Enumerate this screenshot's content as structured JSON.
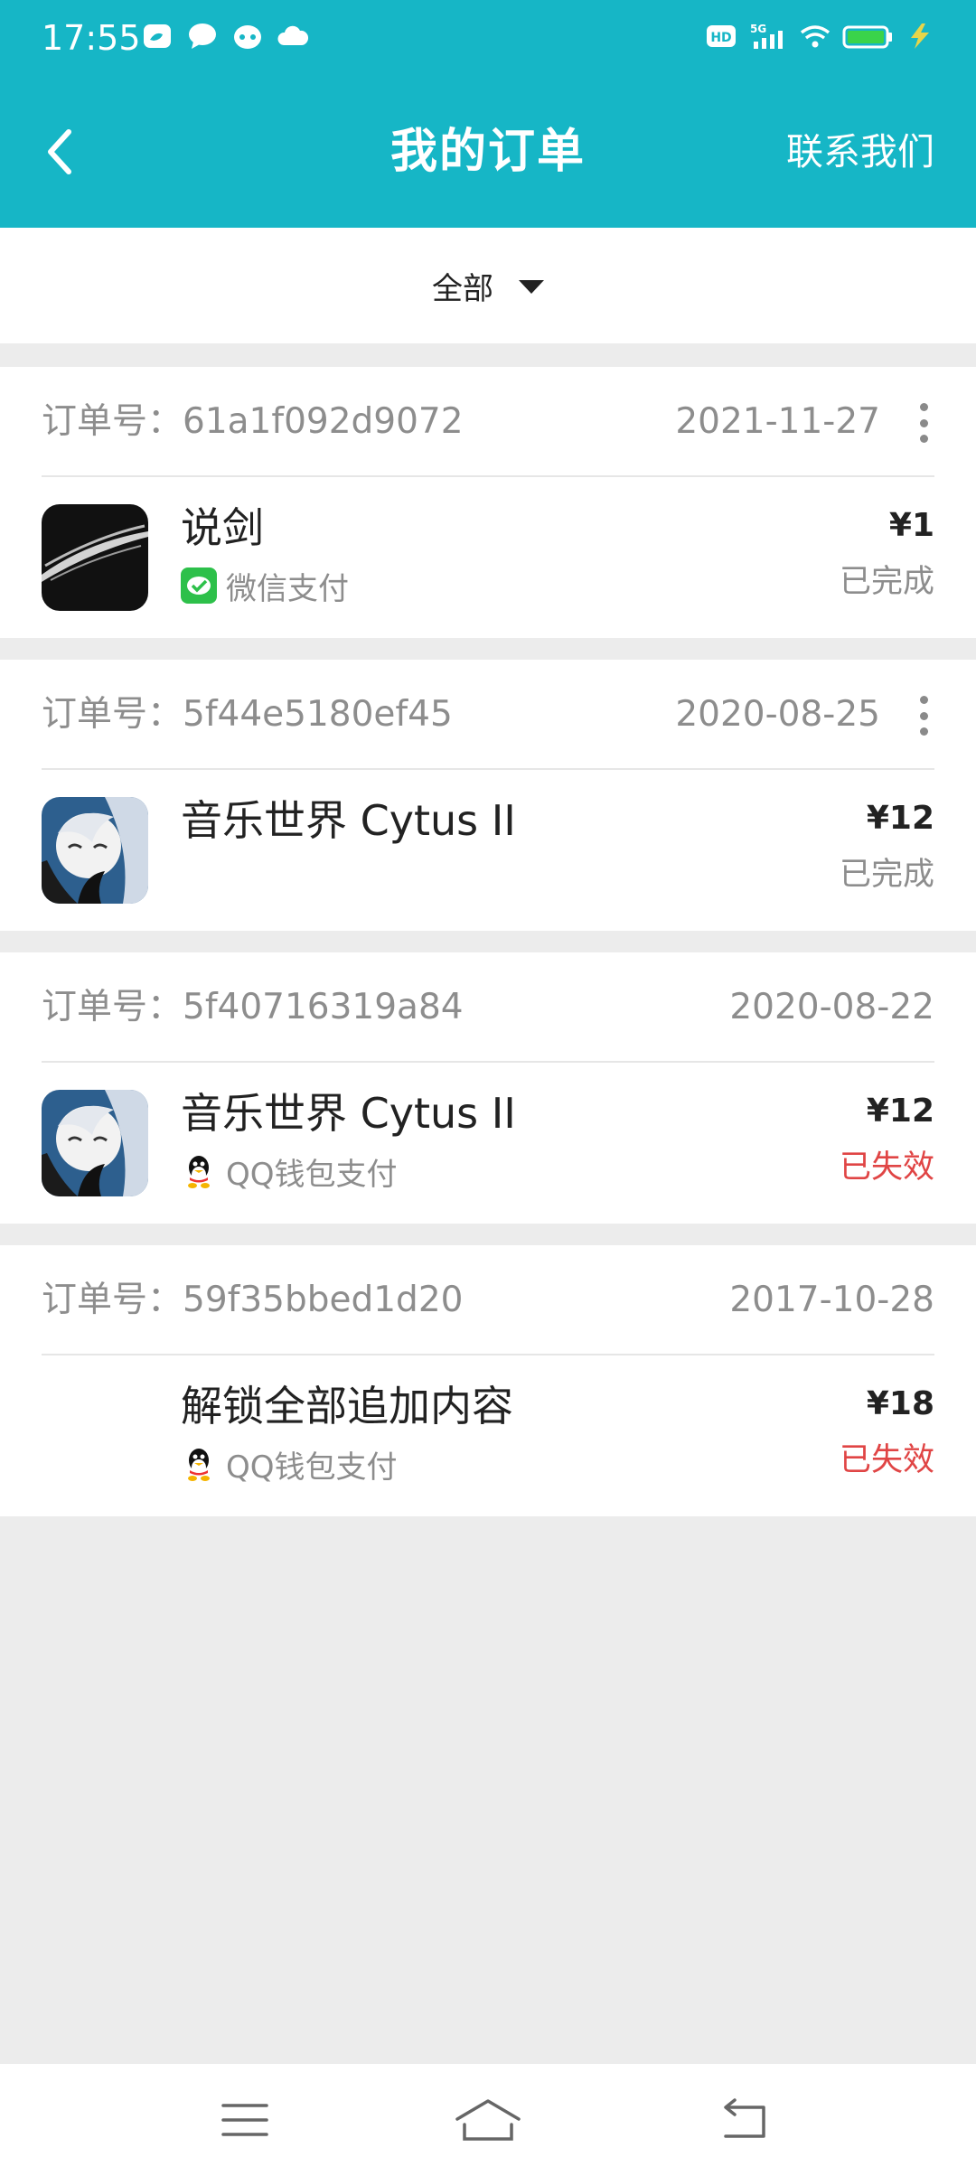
{
  "status_bar": {
    "time": "17:55",
    "left_icons": [
      "weibo-icon",
      "message-icon",
      "game-icon",
      "cloud-icon"
    ],
    "right_icons": [
      "hd-icon",
      "5g-signal-icon",
      "wifi-icon",
      "battery-icon",
      "charging-icon"
    ]
  },
  "nav": {
    "title": "我的订单",
    "contact_label": "联系我们",
    "back_icon": "chevron-left-icon"
  },
  "filter": {
    "label": "全部",
    "icon": "caret-down-icon"
  },
  "colors": {
    "accent": "#16b6c6",
    "failed": "#e04545",
    "muted": "#8d8d8d"
  },
  "orders": [
    {
      "order_no": "订单号：61a1f092d9072",
      "date": "2021-11-27",
      "app_name": "说剑",
      "payment": "微信支付",
      "payment_icon": "wechat-pay-icon",
      "price": "¥1",
      "status": "已完成"
    },
    {
      "order_no": "订单号：5f44e5180ef45",
      "date": "2020-08-25",
      "app_name": "音乐世界 Cytus II",
      "payment": "",
      "price": "¥12",
      "status": "已完成"
    },
    {
      "order_no": "订单号：5f40716319a84",
      "date": "2020-08-22",
      "app_name": "音乐世界 Cytus II",
      "payment": "QQ钱包支付",
      "payment_icon": "qq-wallet-icon",
      "price": "¥12",
      "status": "已失效"
    },
    {
      "order_no": "订单号：59f35bbed1d20",
      "date": "2017-10-28",
      "app_name": "解锁全部追加内容",
      "payment": "QQ钱包支付",
      "payment_icon": "qq-wallet-icon",
      "price": "¥18",
      "status": "已失效"
    }
  ],
  "bottom_nav": {
    "icons": [
      "menu-icon",
      "home-icon",
      "back-icon"
    ]
  }
}
